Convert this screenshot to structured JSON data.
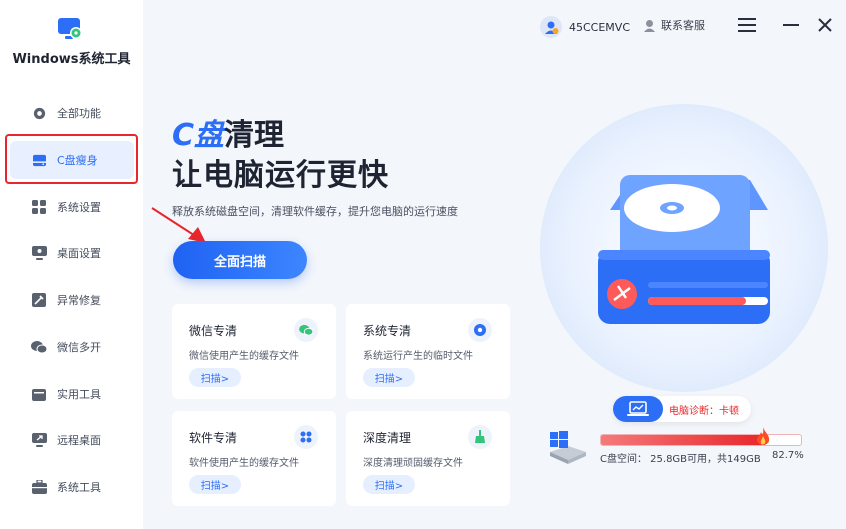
{
  "app": {
    "title": "Windows系统工具"
  },
  "sidebar": {
    "items": [
      {
        "label": "全部功能",
        "icon": "gear-icon"
      },
      {
        "label": "C盘瘦身",
        "icon": "drive-icon",
        "active": true
      },
      {
        "label": "系统设置",
        "icon": "grid-icon"
      },
      {
        "label": "桌面设置",
        "icon": "monitor-icon"
      },
      {
        "label": "异常修复",
        "icon": "wrench-icon"
      },
      {
        "label": "微信多开",
        "icon": "wechat-icon"
      },
      {
        "label": "实用工具",
        "icon": "toolbox-icon"
      },
      {
        "label": "远程桌面",
        "icon": "remote-desktop-icon"
      },
      {
        "label": "系统工具",
        "icon": "briefcase-icon"
      }
    ]
  },
  "topbar": {
    "username": "45CCEMVC",
    "service_label": "联系客服"
  },
  "hero": {
    "title_highlight": "C盘",
    "title_rest": "清理",
    "title_line2": "让电脑运行更快",
    "subtitle": "释放系统磁盘空间，清理软件缓存，提升您电脑的运行速度",
    "scan_button": "全面扫描"
  },
  "cards": [
    {
      "title": "微信专清",
      "desc": "微信使用产生的缓存文件",
      "button": "扫描>",
      "icon": "wechat-icon"
    },
    {
      "title": "系统专清",
      "desc": "系统运行产生的临时文件",
      "button": "扫描>",
      "icon": "settings-gear-icon"
    },
    {
      "title": "软件专清",
      "desc": "软件使用产生的缓存文件",
      "button": "扫描>",
      "icon": "apps-icon"
    },
    {
      "title": "深度清理",
      "desc": "深度清理顽固缓存文件",
      "button": "扫描>",
      "icon": "broom-icon"
    }
  ],
  "diagnosis": {
    "text": "电脑诊断：卡顿"
  },
  "disk": {
    "space_text": "C盘空间：  25.8GB可用，共149GB",
    "usage_percent": "82.7%",
    "usage_fraction": 0.827
  },
  "colors": {
    "accent": "#2d6ef7",
    "warning": "#e8262b"
  }
}
